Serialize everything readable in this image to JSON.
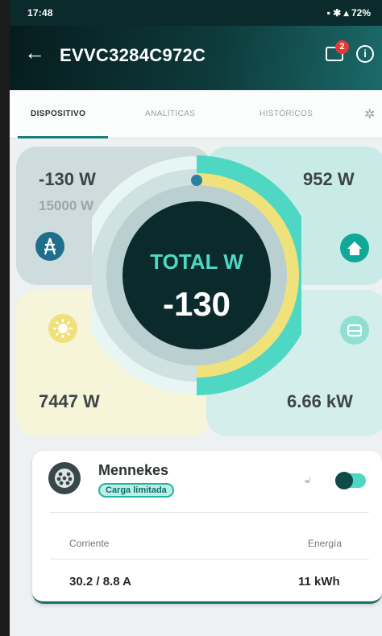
{
  "status_bar": {
    "time": "17:48",
    "battery": "72%"
  },
  "header": {
    "device_id": "EVVC3284C972C",
    "notification_count": "2"
  },
  "tabs": [
    {
      "label": "DISPOSITIVO",
      "active": true
    },
    {
      "label": "ANALÍTICAS",
      "active": false
    },
    {
      "label": "HISTÓRICOS",
      "active": false
    }
  ],
  "energy": {
    "grid": {
      "value": "-130 W",
      "limit": "15000 W"
    },
    "home": {
      "value": "952 W"
    },
    "solar": {
      "value": "7447 W"
    },
    "ev": {
      "value": "6.66 kW"
    },
    "total": {
      "label": "TOTAL W",
      "value": "-130"
    }
  },
  "colors": {
    "teal": "#1a7f7a",
    "dark": "#0b2a2b",
    "solar_yellow": "#f0e27a",
    "ev_green": "#4ed8c3"
  },
  "charger": {
    "name": "Mennekes",
    "status": "Carga limitada",
    "current_label": "Corriente",
    "energy_label": "Energía",
    "current_value": "30.2 / 8.8 A",
    "energy_value": "11 kWh",
    "enabled": true
  }
}
